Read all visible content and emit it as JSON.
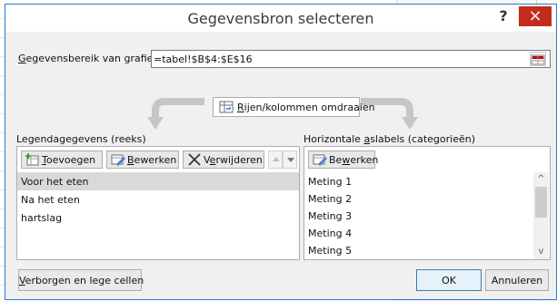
{
  "dialog": {
    "title": "Gegevensbron selecteren",
    "help_label": "?",
    "close_label": "×"
  },
  "range": {
    "label": "Gegevensbereik van grafiek:",
    "label_mnemonic": "G",
    "label_rest": "egevensbereik van grafiek:",
    "value": "=tabel!$B$4:$E$16"
  },
  "switch_button": {
    "label_mnemonic": "R",
    "label_rest": "ijen/kolommen omdraaien",
    "label": "Rijen/kolommen omdraaien"
  },
  "legend_panel": {
    "title": "Legendagegevens (reeks)",
    "title_part1": "Legendagegevens (reeks)",
    "buttons": {
      "add": {
        "mnemonic": "T",
        "rest": "oevoegen",
        "label": "Toevoegen"
      },
      "edit": {
        "mnemonic": "B",
        "rest": "ewerken",
        "label": "Bewerken"
      },
      "remove": {
        "prefix": "V",
        "mnemonic": "e",
        "rest": "rwijderen",
        "label": "Verwijderen"
      }
    },
    "items": [
      {
        "label": "Voor het eten",
        "selected": true
      },
      {
        "label": "Na het eten",
        "selected": false
      },
      {
        "label": "hartslag",
        "selected": false
      }
    ]
  },
  "axis_panel": {
    "title_prefix": "Horizontale ",
    "title_mnemonic": "a",
    "title_rest": "slabels (categorieën)",
    "title": "Horizontale aslabels (categorieën)",
    "edit_button": {
      "prefix": "Be",
      "mnemonic": "w",
      "rest": "erken",
      "label": "Bewerken"
    },
    "items": [
      {
        "label": "Meting 1"
      },
      {
        "label": "Meting 2"
      },
      {
        "label": "Meting 3"
      },
      {
        "label": "Meting 4"
      },
      {
        "label": "Meting 5"
      }
    ],
    "scroll_up": "^",
    "scroll_down": "v"
  },
  "footer": {
    "hidden_cells": {
      "mnemonic": "V",
      "rest": "erborgen en lege cellen",
      "label": "Verborgen en lege cellen"
    },
    "ok_label": "OK",
    "cancel_label": "Annuleren"
  },
  "colors": {
    "accent": "#2d7bd6",
    "close_red": "#c42b1c",
    "selection": "#d9d9d9",
    "dialog_bg": "#f0f0f0"
  },
  "icons": {
    "add": "add-series-icon",
    "edit": "edit-icon",
    "remove": "remove-x-icon",
    "move_up": "move-up-icon",
    "move_down": "move-down-icon",
    "range_picker": "range-picker-icon",
    "switch": "switch-rows-columns-icon"
  }
}
